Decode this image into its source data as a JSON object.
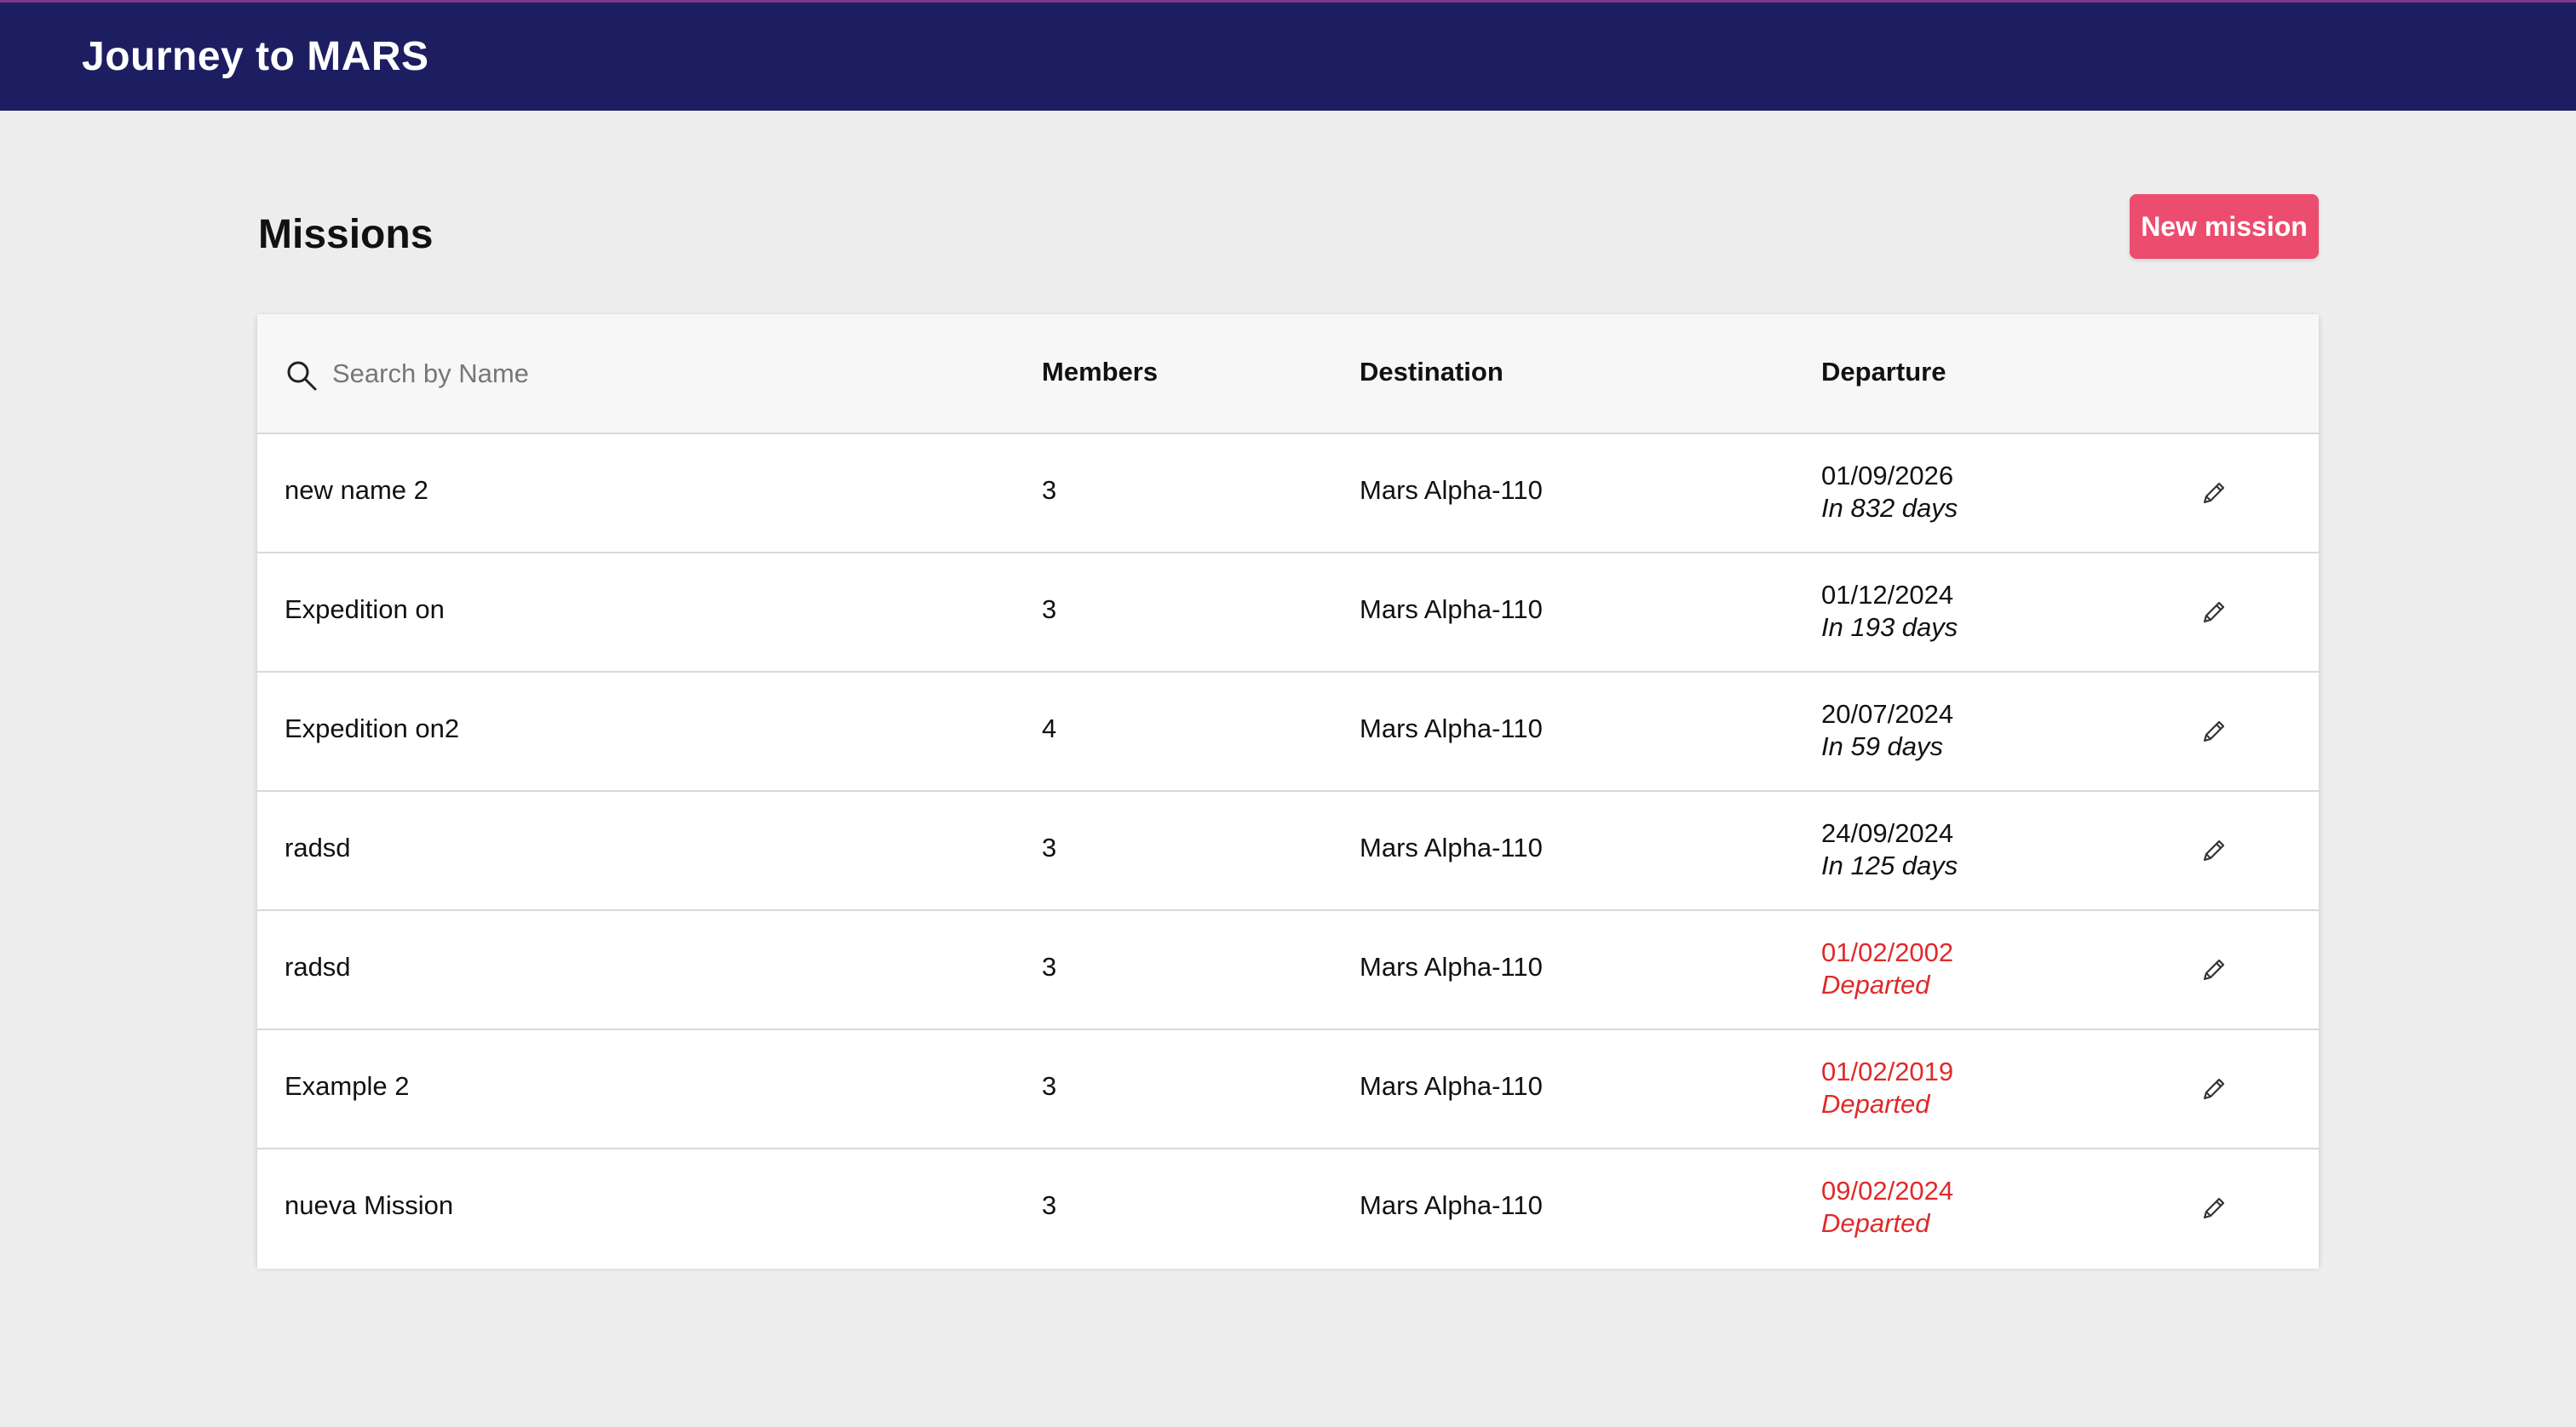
{
  "header": {
    "title": "Journey to MARS"
  },
  "page": {
    "title": "Missions",
    "new_button": "New mission"
  },
  "table": {
    "search_placeholder": "Search by Name",
    "columns": {
      "members": "Members",
      "destination": "Destination",
      "departure": "Departure"
    },
    "rows": [
      {
        "name": "new name 2",
        "members": "3",
        "destination": "Mars Alpha-110",
        "date": "01/09/2026",
        "status": "In 832 days",
        "departed": false
      },
      {
        "name": "Expedition on",
        "members": "3",
        "destination": "Mars Alpha-110",
        "date": "01/12/2024",
        "status": "In 193 days",
        "departed": false
      },
      {
        "name": "Expedition on2",
        "members": "4",
        "destination": "Mars Alpha-110",
        "date": "20/07/2024",
        "status": "In 59 days",
        "departed": false
      },
      {
        "name": "radsd",
        "members": "3",
        "destination": "Mars Alpha-110",
        "date": "24/09/2024",
        "status": "In 125 days",
        "departed": false
      },
      {
        "name": "radsd",
        "members": "3",
        "destination": "Mars Alpha-110",
        "date": "01/02/2002",
        "status": "Departed",
        "departed": true
      },
      {
        "name": "Example 2",
        "members": "3",
        "destination": "Mars Alpha-110",
        "date": "01/02/2019",
        "status": "Departed",
        "departed": true
      },
      {
        "name": "nueva Mission",
        "members": "3",
        "destination": "Mars Alpha-110",
        "date": "09/02/2024",
        "status": "Departed",
        "departed": true
      }
    ]
  },
  "icons": {
    "search": "search-icon",
    "edit": "pencil-icon"
  },
  "colors": {
    "topbar": "#1d1e62",
    "accent": "#ec4d6f",
    "departed": "#e02a2a"
  }
}
